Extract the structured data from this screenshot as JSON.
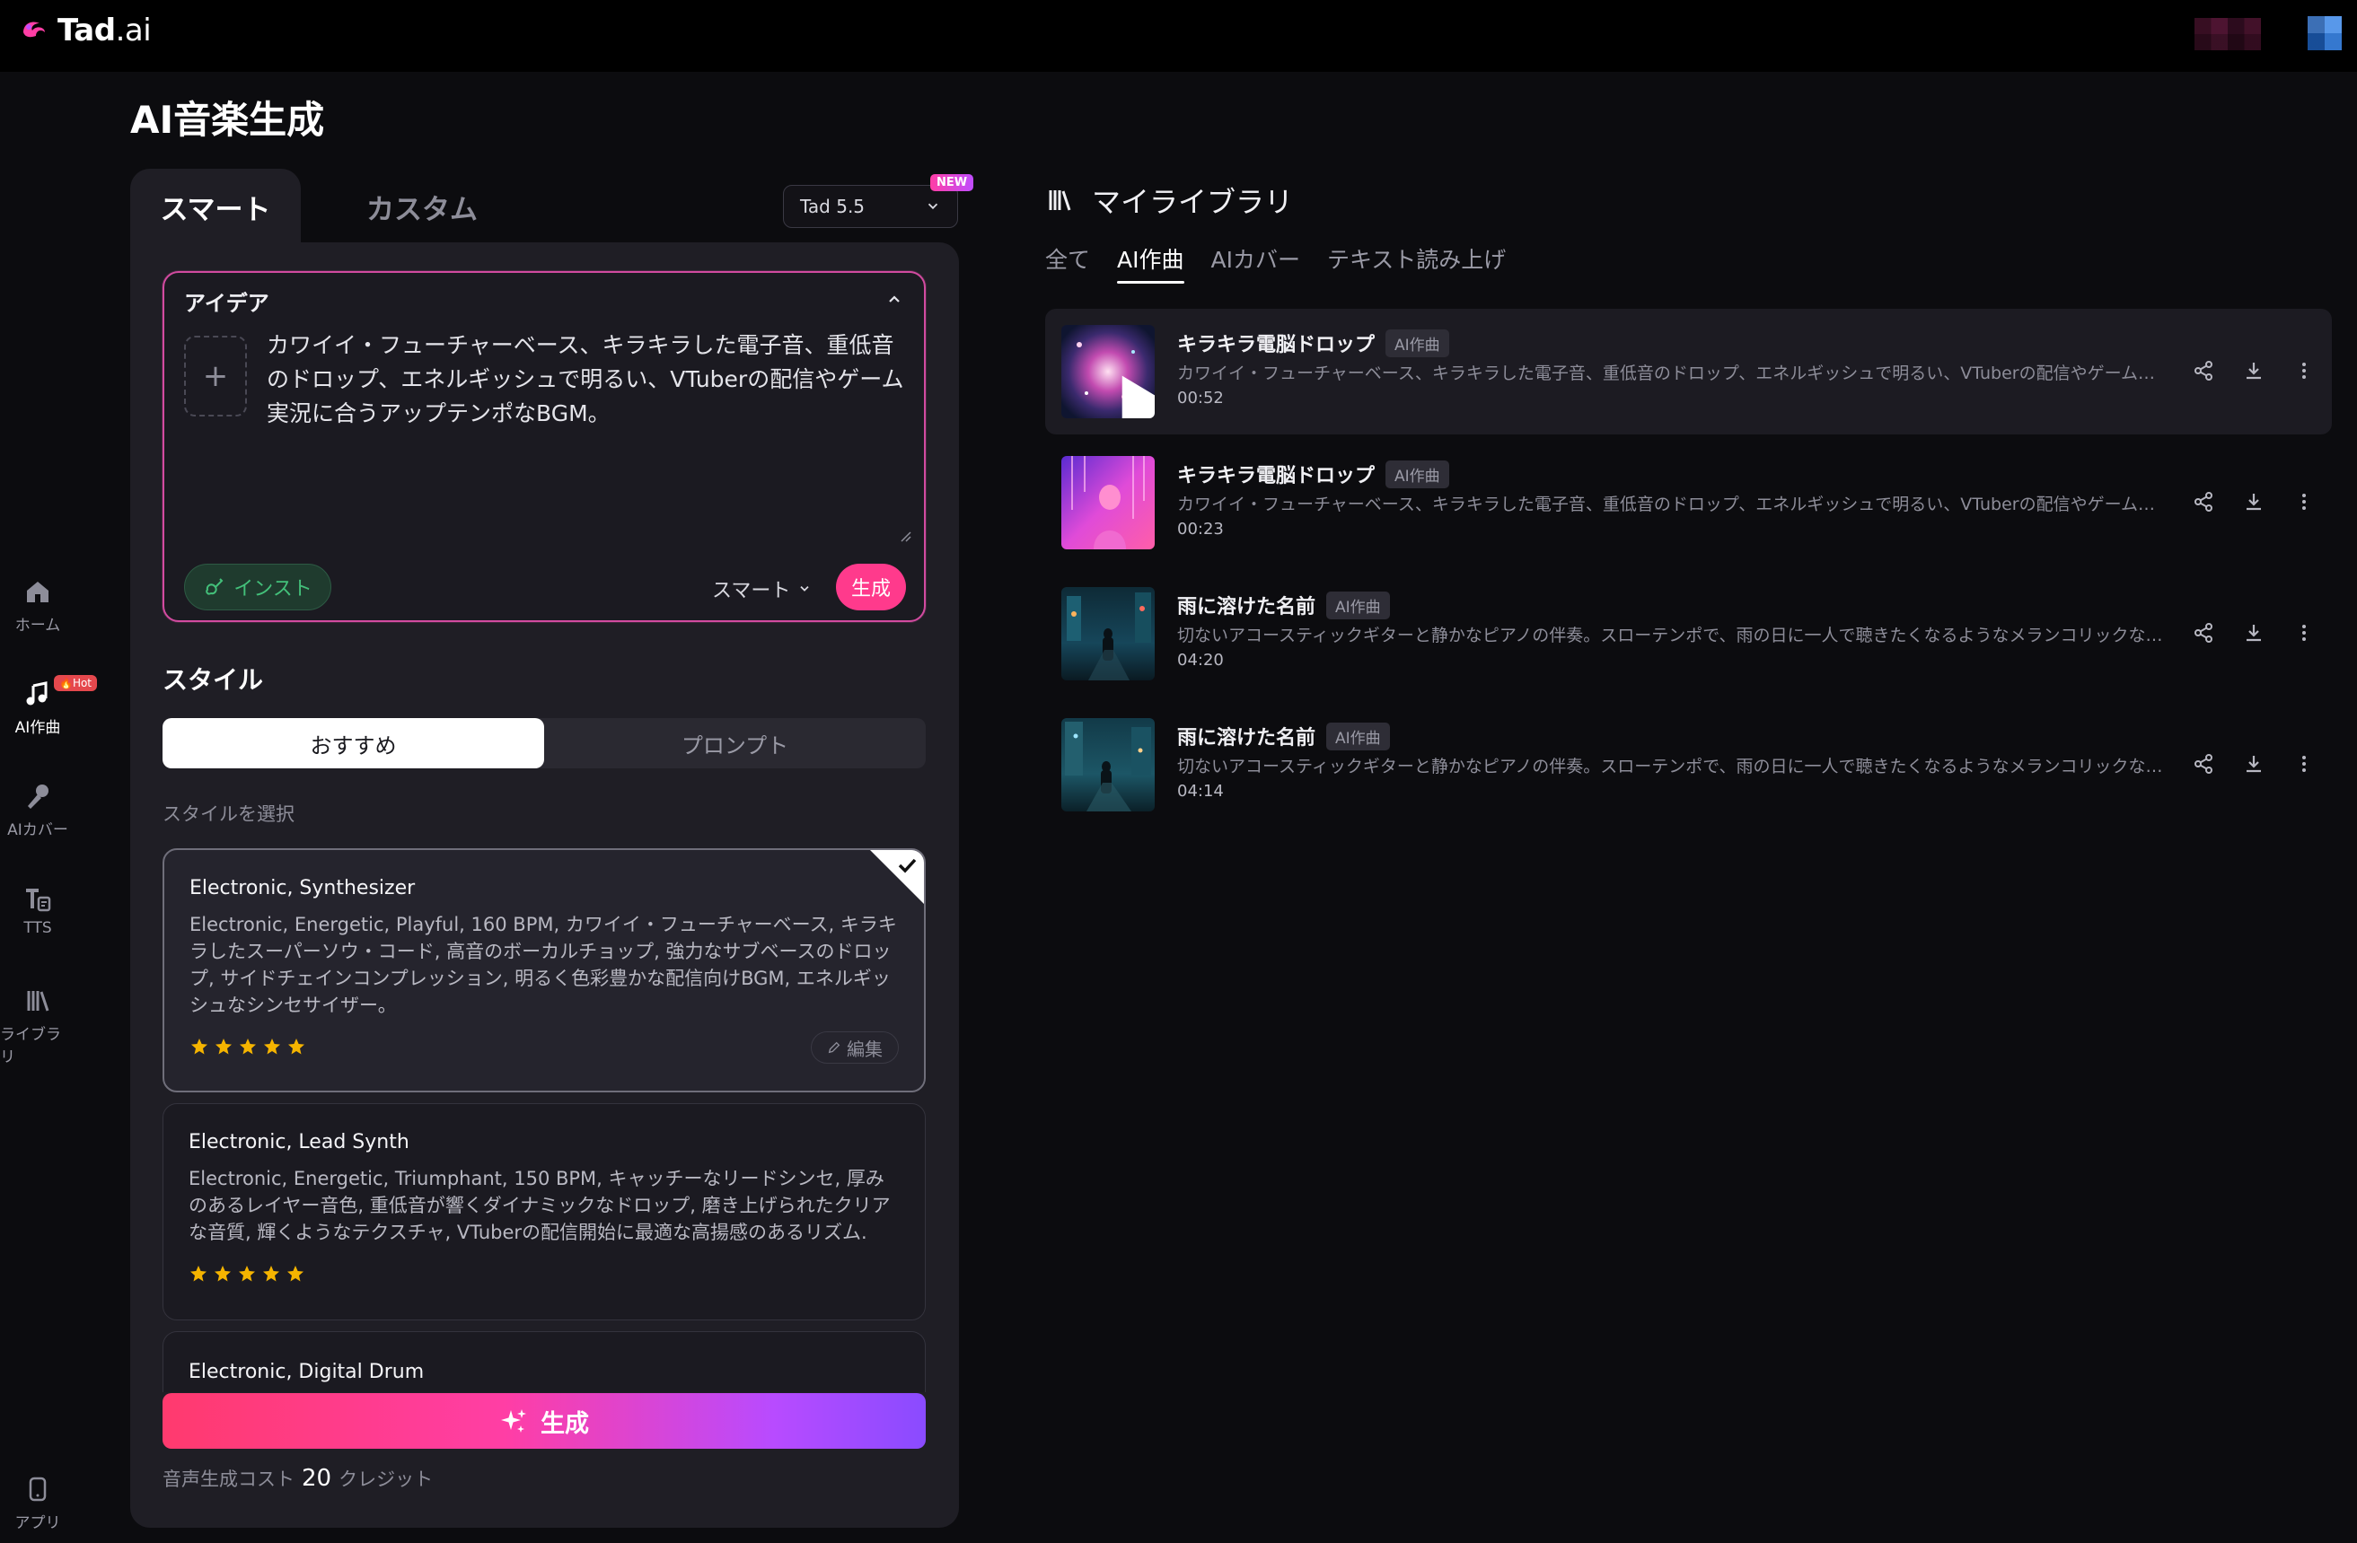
{
  "brand": {
    "name": "Tad",
    "suffix": ".ai"
  },
  "nav": [
    {
      "label": "ホーム",
      "icon": "home-icon"
    },
    {
      "label": "AI作曲",
      "icon": "music-icon",
      "badge": "🔥Hot",
      "active": true
    },
    {
      "label": "AIカバー",
      "icon": "mic-icon"
    },
    {
      "label": "TTS",
      "icon": "tts-icon"
    },
    {
      "label": "ライブラリ",
      "icon": "library-icon"
    },
    {
      "label": "アプリ",
      "icon": "app-icon"
    }
  ],
  "page": {
    "title": "AI音楽生成"
  },
  "tabs": {
    "smart": "スマート",
    "custom": "カスタム"
  },
  "model": {
    "value": "Tad 5.5",
    "badge": "NEW"
  },
  "idea": {
    "label": "アイデア",
    "text": "カワイイ・フューチャーベース、キラキラした電子音、重低音のドロップ、エネルギッシュで明るい、VTuberの配信やゲーム実況に合うアップテンポなBGM。",
    "inst_label": "インスト",
    "mode_label": "スマート",
    "generate_label": "生成",
    "upload_symbol": "+"
  },
  "style": {
    "title": "スタイル",
    "seg_recommend": "おすすめ",
    "seg_prompt": "プロンプト",
    "select_label": "スタイルを選択",
    "edit_label": "編集",
    "cards": [
      {
        "title": "Electronic, Synthesizer",
        "desc": "Electronic, Energetic, Playful, 160 BPM, カワイイ・フューチャーベース, キラキラしたスーパーソウ・コード, 高音のボーカルチョップ, 強力なサブベースのドロップ, サイドチェインコンプレッション, 明るく色彩豊かな配信向けBGM, エネルギッシュなシンセサイザー。",
        "rating": 5,
        "selected": true
      },
      {
        "title": "Electronic, Lead Synth",
        "desc": "Electronic, Energetic, Triumphant, 150 BPM, キャッチーなリードシンセ, 厚みのあるレイヤー音色, 重低音が響くダイナミックなドロップ, 磨き上げられたクリアな音質, 輝くようなテクスチャ, VTuberの配信開始に最適な高揚感のあるリズム.",
        "rating": 5,
        "selected": false
      },
      {
        "title": "Electronic, Digital Drum",
        "desc": "",
        "rating": 0,
        "selected": false
      }
    ]
  },
  "generate": {
    "label": "生成"
  },
  "cost": {
    "prefix": "音声生成コスト",
    "amount": "20",
    "unit": "クレジット"
  },
  "library": {
    "title": "マイライブラリ",
    "tabs": [
      "全て",
      "AI作曲",
      "AIカバー",
      "テキスト読み上げ"
    ],
    "active_tab": 1,
    "songs": [
      {
        "title": "キラキラ電脳ドロップ",
        "tag": "AI作曲",
        "desc": "カワイイ・フューチャーベース、キラキラした電子音、重低音のドロップ、エネルギッシュで明るい、VTuberの配信やゲーム実況に...",
        "duration": "00:52",
        "highlight": true
      },
      {
        "title": "キラキラ電脳ドロップ",
        "tag": "AI作曲",
        "desc": "カワイイ・フューチャーベース、キラキラした電子音、重低音のドロップ、エネルギッシュで明るい、VTuberの配信やゲーム実況に...",
        "duration": "00:23",
        "highlight": false
      },
      {
        "title": "雨に溶けた名前",
        "tag": "AI作曲",
        "desc": "切ないアコースティックギターと静かなピアノの伴奏。スローテンポで、雨の日に一人で聴きたくなるようなメランコリックな雰囲...",
        "duration": "04:20",
        "highlight": false
      },
      {
        "title": "雨に溶けた名前",
        "tag": "AI作曲",
        "desc": "切ないアコースティックギターと静かなピアノの伴奏。スローテンポで、雨の日に一人で聴きたくなるようなメランコリックな雰囲...",
        "duration": "04:14",
        "highlight": false
      }
    ]
  },
  "colors": {
    "accent": "#ff3a8c",
    "inst_green": "#43c07a",
    "star": "#f5b400"
  }
}
